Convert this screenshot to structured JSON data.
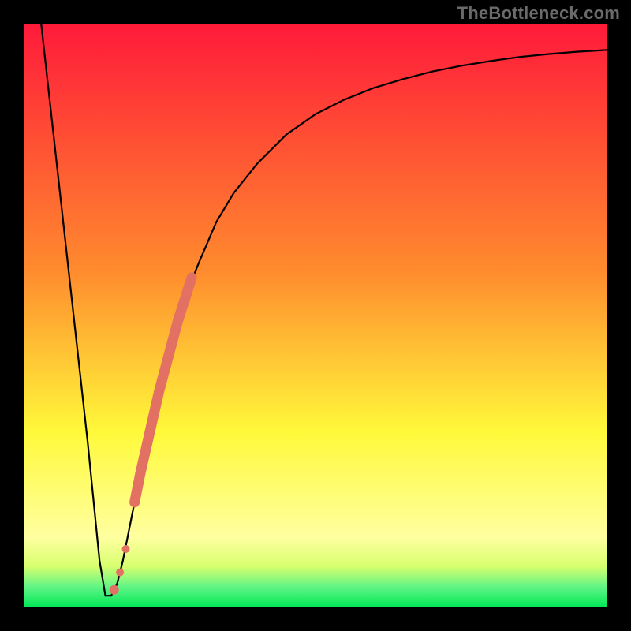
{
  "watermark": "TheBottleneck.com",
  "colors": {
    "black": "#000000",
    "curve": "#000000",
    "marker": "#e27063",
    "green": "#00e756",
    "yellow": "#fff93a",
    "orange": "#ffa232",
    "red": "#ff1a3a"
  },
  "chart_data": {
    "type": "line",
    "title": "",
    "xlabel": "",
    "ylabel": "",
    "xlim": [
      0,
      100
    ],
    "ylim": [
      0,
      100
    ],
    "grid": false,
    "legend": false,
    "curve": {
      "x": [
        3,
        5,
        7,
        9,
        11,
        12,
        13,
        14,
        15,
        16,
        17,
        18,
        19,
        20,
        22,
        24,
        26,
        28,
        30,
        33,
        36,
        40,
        45,
        50,
        55,
        60,
        65,
        70,
        75,
        80,
        85,
        90,
        95,
        100
      ],
      "y": [
        100,
        82,
        64,
        46,
        28,
        18,
        8,
        2,
        2,
        4,
        8,
        13,
        18,
        23,
        32,
        40,
        47,
        54,
        59,
        66,
        71,
        76,
        81,
        84.5,
        87,
        89,
        90.5,
        91.8,
        92.8,
        93.6,
        94.3,
        94.8,
        95.2,
        95.5
      ]
    },
    "markers": {
      "name": "highlighted-segment",
      "x": [
        15.5,
        16.5,
        17.5,
        19,
        20,
        20.8,
        21.6,
        22.4,
        23.2,
        24,
        24.8,
        25.6,
        26.4,
        27.2,
        28,
        28.8
      ],
      "y": [
        3,
        6,
        10,
        18,
        23,
        26.5,
        30,
        33.5,
        37,
        40,
        43,
        46,
        49,
        51.5,
        54,
        56.5
      ]
    },
    "gradient_stops": [
      {
        "offset": 0.0,
        "color": "#ff1a3a"
      },
      {
        "offset": 0.42,
        "color": "#ff8a2e"
      },
      {
        "offset": 0.7,
        "color": "#fff93a"
      },
      {
        "offset": 0.88,
        "color": "#ffffa0"
      },
      {
        "offset": 0.93,
        "color": "#d7ff6e"
      },
      {
        "offset": 0.965,
        "color": "#60f585"
      },
      {
        "offset": 1.0,
        "color": "#00e756"
      }
    ]
  }
}
